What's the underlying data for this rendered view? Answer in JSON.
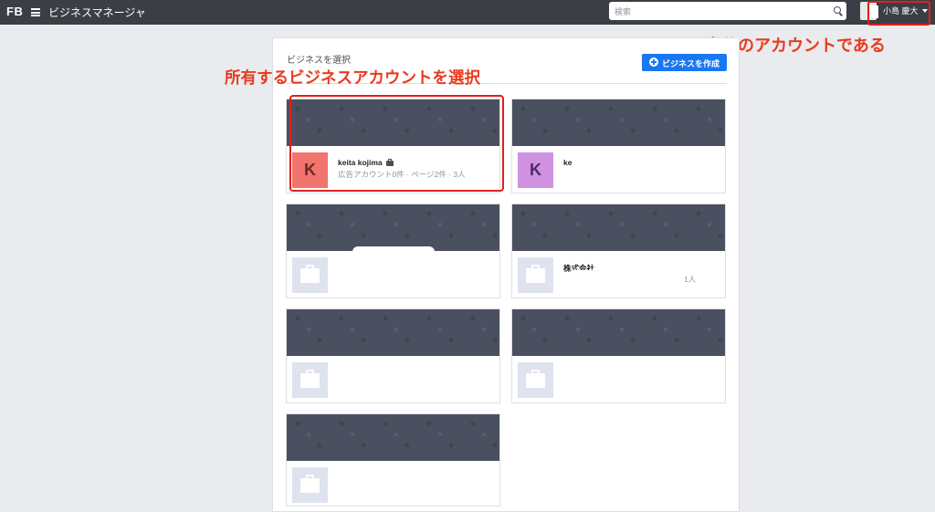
{
  "topbar": {
    "logo": "FB",
    "app_title": "ビジネスマネージャ",
    "search_placeholder": "検索",
    "user_name": "小島 慶大"
  },
  "annotations": {
    "own_account": "自分のアカウントである",
    "select_business": "所有するビジネスアカウントを選択"
  },
  "panel": {
    "title": "ビジネスを選択",
    "create_button": "ビジネスを作成"
  },
  "businesses": [
    {
      "name": "keita kojima",
      "meta": "広告アカウント0件 · ページ2件 · 3人",
      "avatar": "K"
    },
    {
      "name": "ke",
      "meta": "",
      "avatar": "K"
    },
    {
      "name": "",
      "meta": ""
    },
    {
      "name": "株式会社",
      "meta": "1人"
    },
    {
      "name": "",
      "meta": ""
    },
    {
      "name": "",
      "meta": ""
    },
    {
      "name": "",
      "meta": ""
    }
  ],
  "colors": {
    "topbar": "#3b3e45",
    "accent_blue": "#1877f2",
    "annotation_red": "#e0201a",
    "avatar_red": "#f2746e",
    "avatar_purple": "#cf92e0"
  }
}
